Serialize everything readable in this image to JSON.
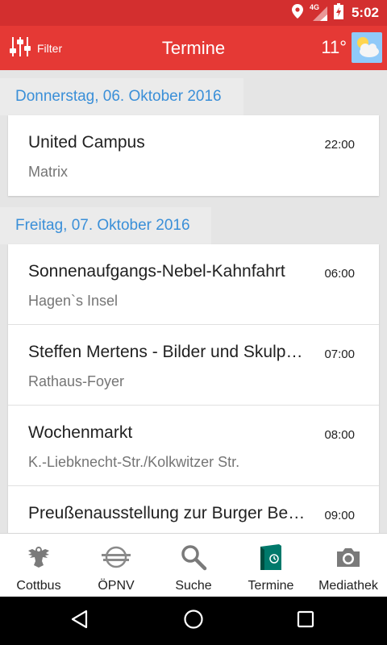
{
  "status_bar": {
    "network_label": "4G",
    "time": "5:02"
  },
  "app_bar": {
    "filter_label": "Filter",
    "title": "Termine",
    "temperature": "11°",
    "weather_icon": "partly-cloudy-icon"
  },
  "sections": [
    {
      "date": "Donnerstag, 06. Oktober 2016",
      "events": [
        {
          "title": "United Campus",
          "location": "Matrix",
          "time": "22:00"
        }
      ]
    },
    {
      "date": "Freitag, 07. Oktober 2016",
      "events": [
        {
          "title": "Sonnenaufgangs-Nebel-Kahnfahrt",
          "location": "Hagen`s Insel",
          "time": "06:00"
        },
        {
          "title": "Steffen Mertens - Bilder und Skulpt…",
          "location": "Rathaus-Foyer",
          "time": "07:00"
        },
        {
          "title": "Wochenmarkt",
          "location": "K.-Liebknecht-Str./Kolkwitzer Str.",
          "time": "08:00"
        },
        {
          "title": "Preußenausstellung zur Burger Bes…",
          "location": "",
          "time": "09:00"
        }
      ]
    }
  ],
  "bottom_nav": [
    {
      "label": "Cottbus",
      "icon": "crest-icon"
    },
    {
      "label": "ÖPNV",
      "icon": "transit-icon"
    },
    {
      "label": "Suche",
      "icon": "search-icon"
    },
    {
      "label": "Termine",
      "icon": "calendar-icon",
      "active": true
    },
    {
      "label": "Mediathek",
      "icon": "camera-icon"
    }
  ],
  "colors": {
    "primary": "#e53935",
    "status_bar": "#d32f2f",
    "date_header": "#3a8fd8",
    "active_tab": "#00796b"
  }
}
